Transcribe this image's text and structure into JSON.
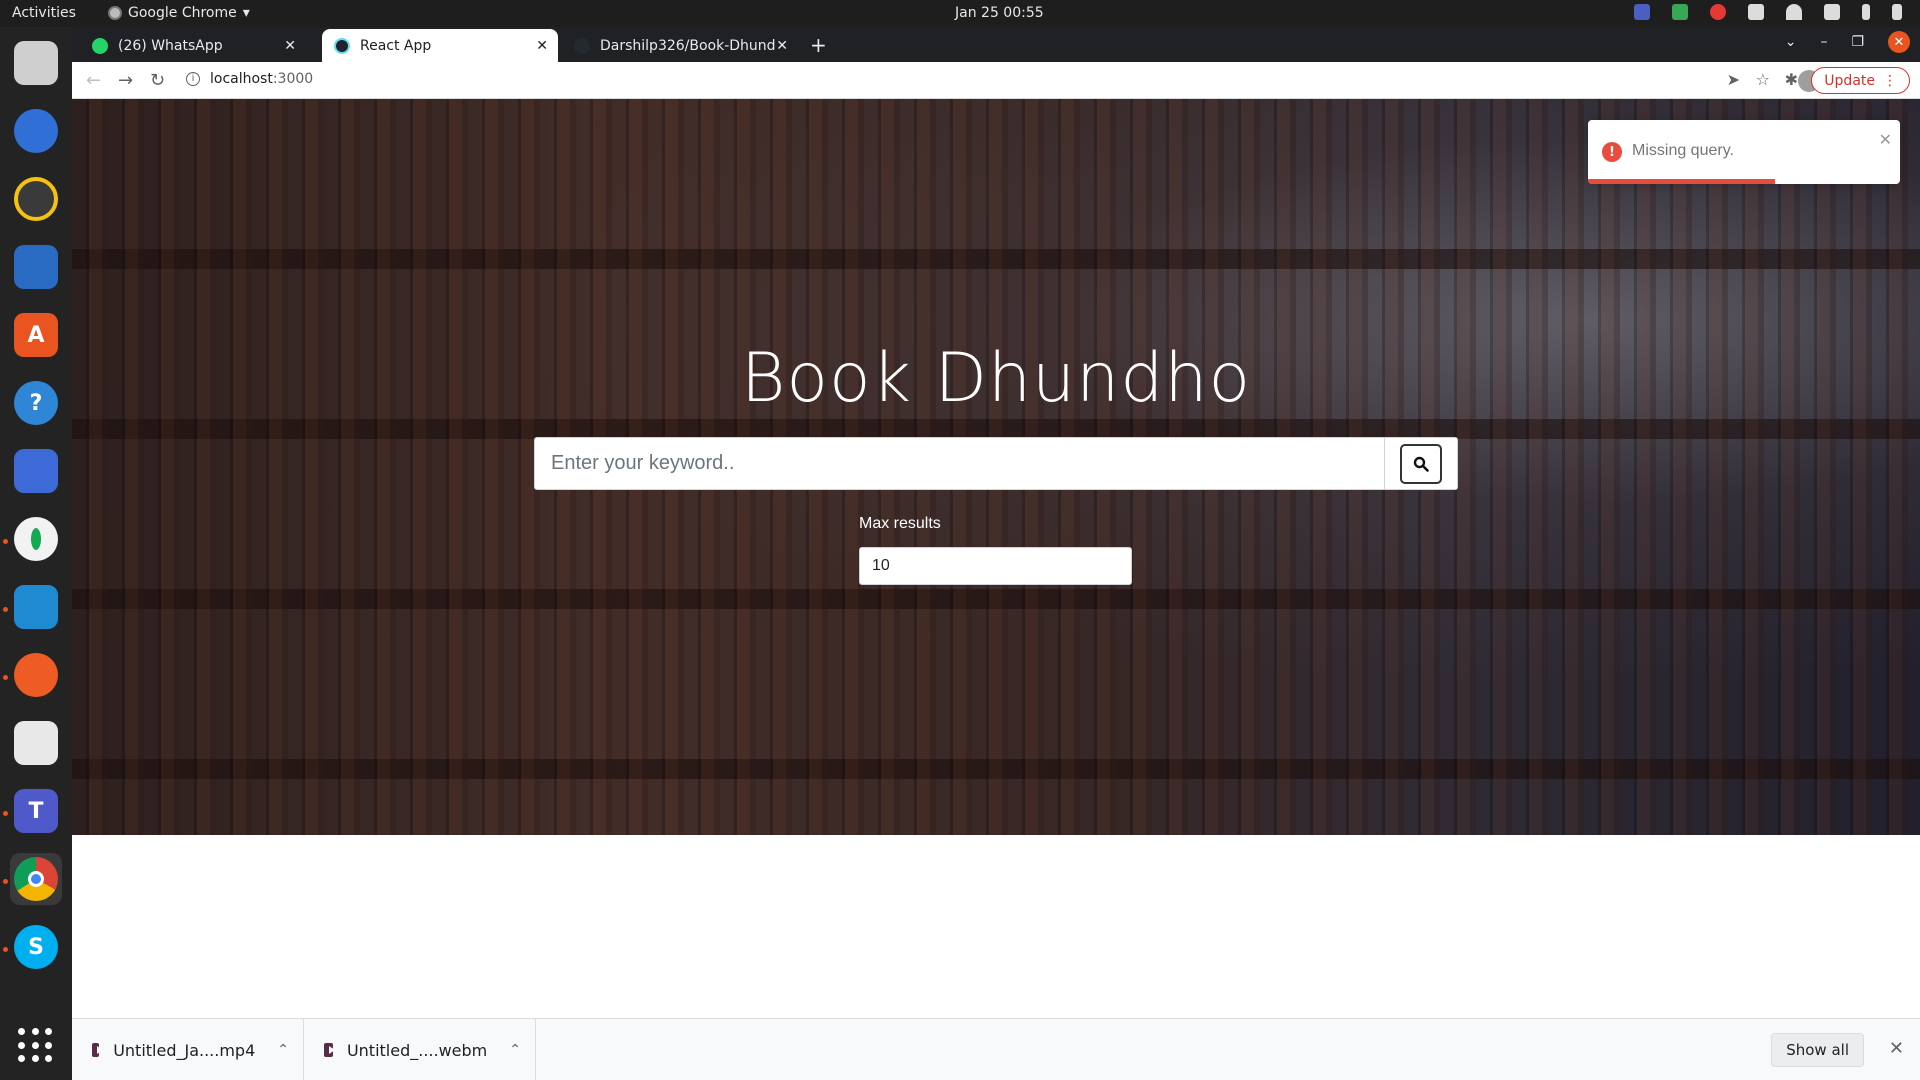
{
  "system": {
    "activities": "Activities",
    "app_name": "Google Chrome",
    "clock": "Jan 25  00:55"
  },
  "tabs": [
    {
      "title": "(26) WhatsApp",
      "favicon_color": "#25d366"
    },
    {
      "title": "React App",
      "favicon_color": "#61dafb"
    },
    {
      "title": "Darshilp326/Book-Dhund",
      "favicon_color": "#24292e"
    }
  ],
  "toolbar": {
    "url_host": "localhost",
    "url_port": ":3000",
    "update_label": "Update"
  },
  "hero": {
    "title": "Book Dhundho",
    "search_placeholder": "Enter your keyword..",
    "search_value": "",
    "max_results_label": "Max results",
    "max_results_value": "10"
  },
  "toast": {
    "message": "Missing query.",
    "type": "error",
    "progress": 0.6
  },
  "downloads": {
    "items": [
      {
        "name": "Untitled_Ja....mp4"
      },
      {
        "name": "Untitled_....webm"
      }
    ],
    "show_all_label": "Show all"
  },
  "colors": {
    "error": "#e74c3c",
    "ubuntu_accent": "#e95420",
    "update_red": "#d93025"
  },
  "dock_icons": [
    "files-icon",
    "thunderbird-icon",
    "rhythmbox-icon",
    "libreoffice-writer-icon",
    "software-center-icon",
    "help-icon",
    "screenshot-icon",
    "mongodb-compass-icon",
    "vscode-icon",
    "postman-icon",
    "document-viewer-icon",
    "teams-icon",
    "chrome-icon",
    "skype-icon"
  ]
}
